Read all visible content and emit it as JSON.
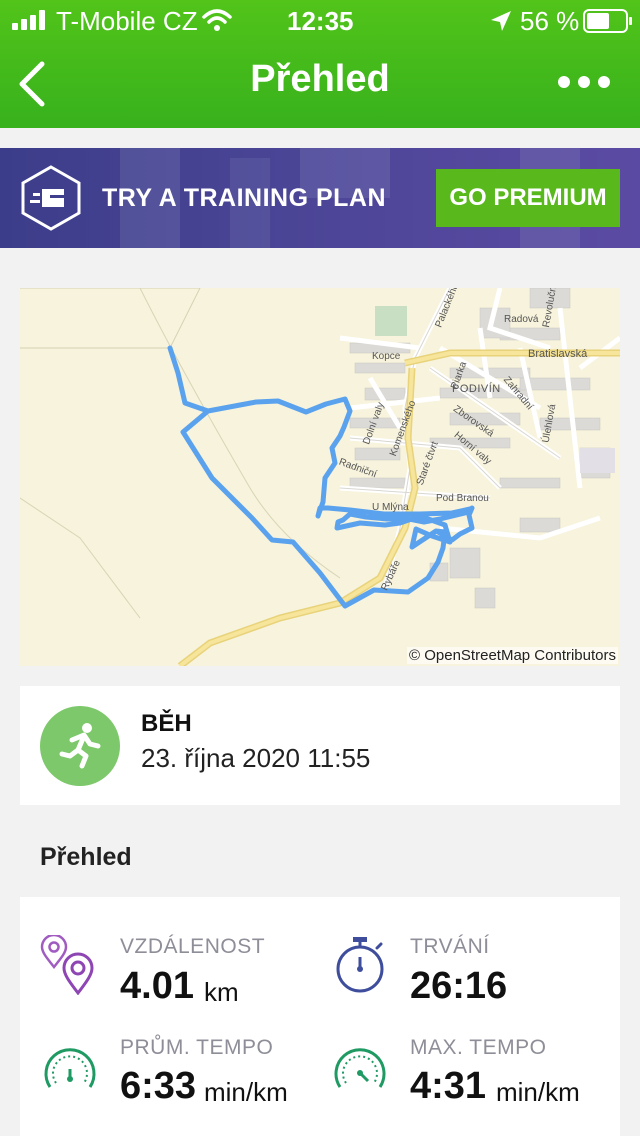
{
  "status_bar": {
    "carrier": "T-Mobile CZ",
    "time": "12:35",
    "battery": "56 %"
  },
  "nav": {
    "title": "Přehled"
  },
  "promo": {
    "text": "TRY A TRAINING PLAN",
    "button": "GO PREMIUM"
  },
  "map": {
    "attribution": "© OpenStreetMap Contributors",
    "labels": [
      "Palackého",
      "Radová",
      "Bratislavská",
      "Kopce",
      "PODIVÍN",
      "Komenského",
      "Zborovská",
      "Zahradní",
      "Horní valy",
      "Dolní valy",
      "Radniční",
      "Staré čtvrt",
      "Pod Branou",
      "U Mlýna",
      "Rybáře",
      "Piarka",
      "Úlehlová",
      "Revoluční"
    ]
  },
  "activity": {
    "type": "BĚH",
    "date": "23. října 2020 11:55"
  },
  "section_title": "Přehled",
  "stats": {
    "distance": {
      "label": "VZDÁLENOST",
      "value": "4.01",
      "unit": "km"
    },
    "duration": {
      "label": "TRVÁNÍ",
      "value": "26:16",
      "unit": ""
    },
    "avg_pace": {
      "label": "PRŮM. TEMPO",
      "value": "6:33",
      "unit": "min/km"
    },
    "max_pace": {
      "label": "MAX. TEMPO",
      "value": "4:31",
      "unit": "min/km"
    }
  },
  "colors": {
    "header_green": "#37b11c",
    "promo_purple": "#4b4596",
    "route_blue": "#5aa2ee",
    "run_green": "#7cc86a"
  }
}
